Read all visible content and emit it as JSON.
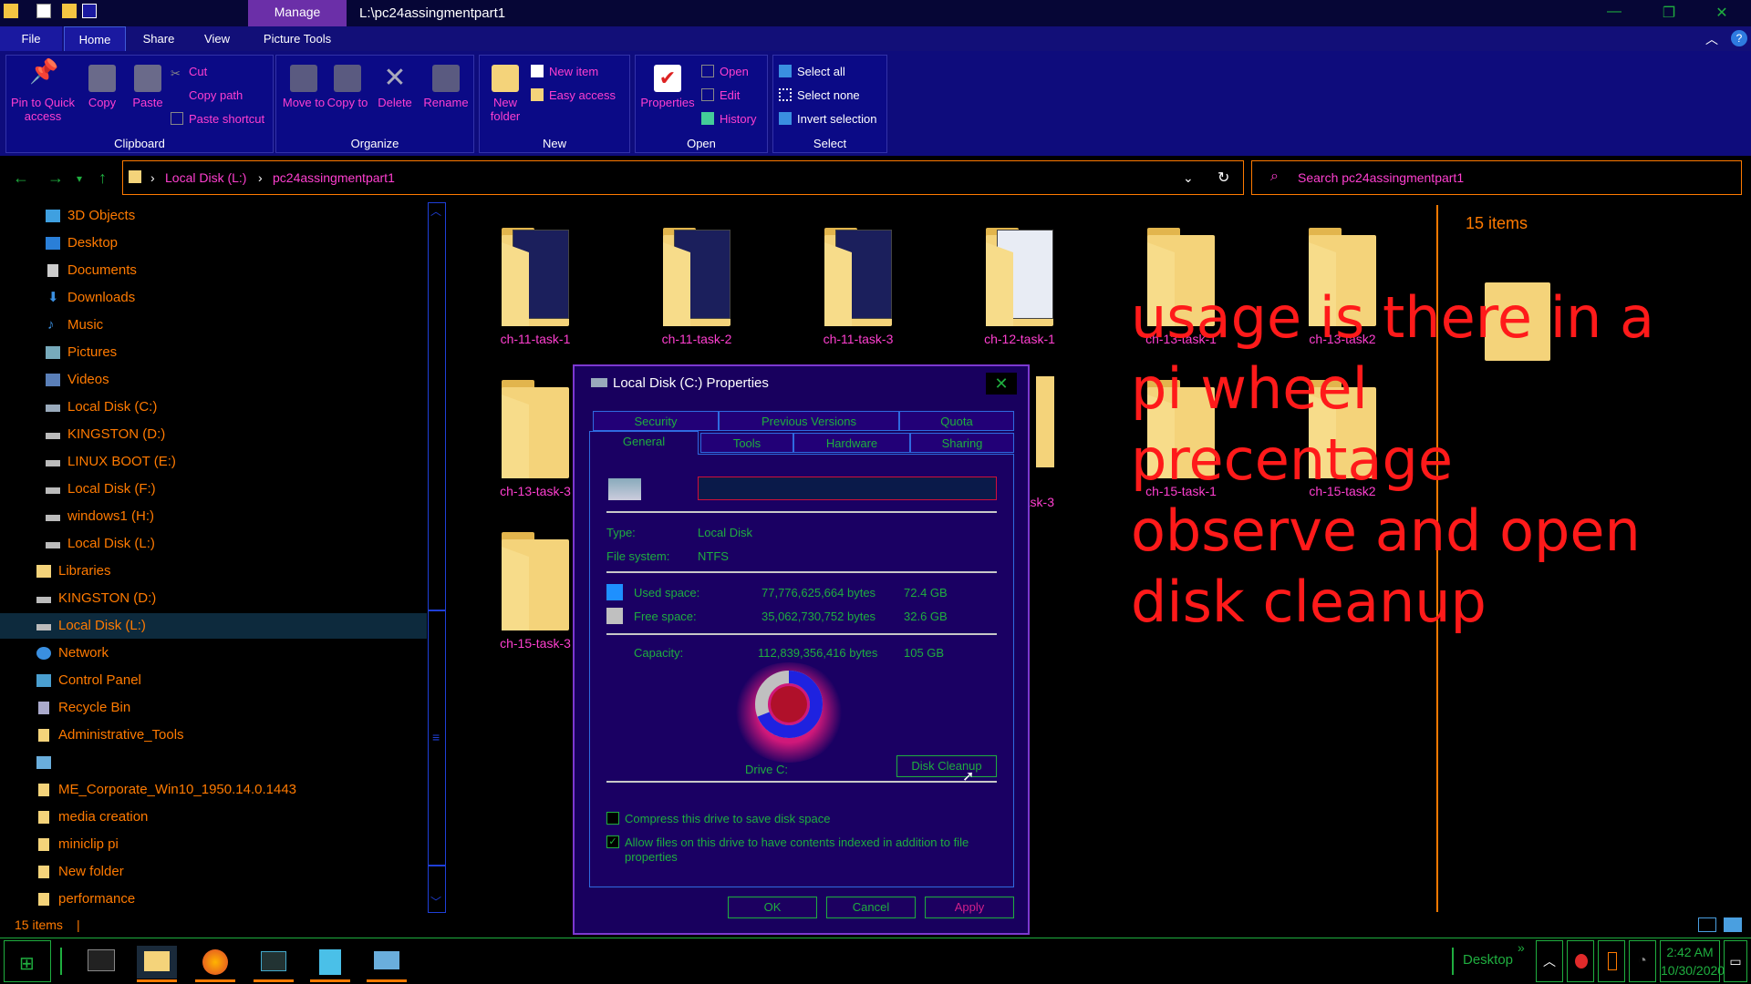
{
  "window": {
    "manage_tab": "Manage",
    "title_path": "L:\\pc24assingmentpart1"
  },
  "menu": {
    "tabs": [
      "File",
      "Home",
      "Share",
      "View",
      "Picture Tools"
    ]
  },
  "ribbon": {
    "clipboard": {
      "pin": "Pin to Quick access",
      "copy": "Copy",
      "paste": "Paste",
      "cut": "Cut",
      "copy_path": "Copy path",
      "paste_shortcut": "Paste shortcut",
      "label": "Clipboard"
    },
    "organize": {
      "move_to": "Move to",
      "copy_to": "Copy to",
      "delete": "Delete",
      "rename": "Rename",
      "label": "Organize"
    },
    "new": {
      "new_folder": "New folder",
      "new_item": "New item",
      "easy_access": "Easy access",
      "label": "New"
    },
    "open": {
      "properties": "Properties",
      "open": "Open",
      "edit": "Edit",
      "history": "History",
      "label": "Open"
    },
    "select": {
      "select_all": "Select all",
      "select_none": "Select none",
      "invert": "Invert selection",
      "label": "Select"
    }
  },
  "address": {
    "crumbs": [
      "Local Disk (L:)",
      "pc24assingmentpart1"
    ],
    "search_placeholder": "Search pc24assingmentpart1"
  },
  "sidebar": {
    "items": [
      "3D Objects",
      "Desktop",
      "Documents",
      "Downloads",
      "Music",
      "Pictures",
      "Videos",
      "Local Disk (C:)",
      "KINGSTON (D:)",
      "LINUX BOOT (E:)",
      "Local Disk (F:)",
      "windows1 (H:)",
      "Local Disk (L:)",
      "Libraries",
      "KINGSTON (D:)",
      "Local Disk (L:)",
      "Network",
      "Control Panel",
      "Recycle Bin",
      "Administrative_Tools",
      "",
      "ME_Corporate_Win10_1950.14.0.1443",
      "media creation",
      "miniclip pi",
      "New folder",
      "performance"
    ]
  },
  "files": {
    "count_label": "15 items",
    "items": [
      "ch-11-task-1",
      "ch-11-task-2",
      "ch-11-task-3",
      "ch-12-task-1",
      "ch-13-task-1",
      "ch-13-task2",
      "ch-13-task-3",
      "ask-3",
      "ch-15-task-1",
      "ch-15-task2",
      "ch-15-task-3"
    ]
  },
  "overlay_note": "usage is there in a\npi wheel\nprecentage\nobserve and open\ndisk cleanup",
  "status": {
    "items": "15 items"
  },
  "dialog": {
    "title": "Local Disk (C:) Properties",
    "close": "✕",
    "tabs_row1": [
      "Security",
      "Previous Versions",
      "Quota"
    ],
    "tabs_row2": [
      "General",
      "Tools",
      "Hardware",
      "Sharing"
    ],
    "name_value": "",
    "type_label": "Type:",
    "type_value": "Local Disk",
    "fs_label": "File system:",
    "fs_value": "NTFS",
    "used_label": "Used space:",
    "used_bytes": "77,776,625,664 bytes",
    "used_gb": "72.4 GB",
    "free_label": "Free space:",
    "free_bytes": "35,062,730,752 bytes",
    "free_gb": "32.6 GB",
    "capacity_label": "Capacity:",
    "capacity_bytes": "112,839,356,416 bytes",
    "capacity_gb": "105 GB",
    "drive_label": "Drive C:",
    "used_fraction": 0.689,
    "cleanup": "Disk Cleanup",
    "compress": "Compress this drive to save disk space",
    "index": "Allow files on this drive to have contents indexed in addition to file properties",
    "ok": "OK",
    "cancel": "Cancel",
    "apply": "Apply",
    "colors": {
      "used": "#1e90ff",
      "free": "#c0c0c0"
    }
  },
  "taskbar": {
    "desktop": "Desktop",
    "time": "2:42 AM",
    "date": "10/30/2020"
  }
}
